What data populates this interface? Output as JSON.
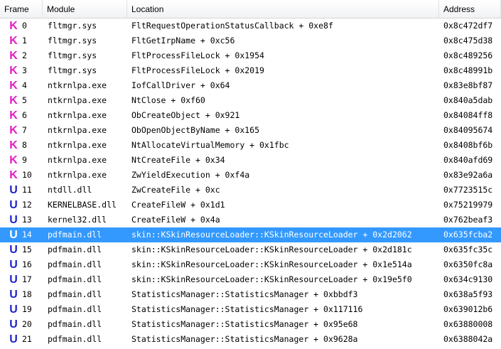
{
  "columns": {
    "frame": "Frame",
    "module": "Module",
    "location": "Location",
    "address": "Address"
  },
  "colors": {
    "kernel_marker": "#e31bc6",
    "user_marker": "#1f22c9",
    "selection": "#3399ff"
  },
  "selected_frame": 14,
  "frames": [
    {
      "kind": "K",
      "frame": "0",
      "module": "fltmgr.sys",
      "location": "FltRequestOperationStatusCallback + 0xe8f",
      "address": "0x8c472df7"
    },
    {
      "kind": "K",
      "frame": "1",
      "module": "fltmgr.sys",
      "location": "FltGetIrpName + 0xc56",
      "address": "0x8c475d38"
    },
    {
      "kind": "K",
      "frame": "2",
      "module": "fltmgr.sys",
      "location": "FltProcessFileLock + 0x1954",
      "address": "0x8c489256"
    },
    {
      "kind": "K",
      "frame": "3",
      "module": "fltmgr.sys",
      "location": "FltProcessFileLock + 0x2019",
      "address": "0x8c48991b"
    },
    {
      "kind": "K",
      "frame": "4",
      "module": "ntkrnlpa.exe",
      "location": "IofCallDriver + 0x64",
      "address": "0x83e8bf87"
    },
    {
      "kind": "K",
      "frame": "5",
      "module": "ntkrnlpa.exe",
      "location": "NtClose + 0xf60",
      "address": "0x840a5dab"
    },
    {
      "kind": "K",
      "frame": "6",
      "module": "ntkrnlpa.exe",
      "location": "ObCreateObject + 0x921",
      "address": "0x84084ff8"
    },
    {
      "kind": "K",
      "frame": "7",
      "module": "ntkrnlpa.exe",
      "location": "ObOpenObjectByName + 0x165",
      "address": "0x84095674"
    },
    {
      "kind": "K",
      "frame": "8",
      "module": "ntkrnlpa.exe",
      "location": "NtAllocateVirtualMemory + 0x1fbc",
      "address": "0x8408bf6b"
    },
    {
      "kind": "K",
      "frame": "9",
      "module": "ntkrnlpa.exe",
      "location": "NtCreateFile + 0x34",
      "address": "0x840afd69"
    },
    {
      "kind": "K",
      "frame": "10",
      "module": "ntkrnlpa.exe",
      "location": "ZwYieldExecution + 0xf4a",
      "address": "0x83e92a6a"
    },
    {
      "kind": "U",
      "frame": "11",
      "module": "ntdll.dll",
      "location": "ZwCreateFile + 0xc",
      "address": "0x7723515c"
    },
    {
      "kind": "U",
      "frame": "12",
      "module": "KERNELBASE.dll",
      "location": "CreateFileW + 0x1d1",
      "address": "0x75219979"
    },
    {
      "kind": "U",
      "frame": "13",
      "module": "kernel32.dll",
      "location": "CreateFileW + 0x4a",
      "address": "0x762beaf3"
    },
    {
      "kind": "U",
      "frame": "14",
      "module": "pdfmain.dll",
      "location": "skin::KSkinResourceLoader::KSkinResourceLoader + 0x2d2062",
      "address": "0x635fcba2"
    },
    {
      "kind": "U",
      "frame": "15",
      "module": "pdfmain.dll",
      "location": "skin::KSkinResourceLoader::KSkinResourceLoader + 0x2d181c",
      "address": "0x635fc35c"
    },
    {
      "kind": "U",
      "frame": "16",
      "module": "pdfmain.dll",
      "location": "skin::KSkinResourceLoader::KSkinResourceLoader + 0x1e514a",
      "address": "0x6350fc8a"
    },
    {
      "kind": "U",
      "frame": "17",
      "module": "pdfmain.dll",
      "location": "skin::KSkinResourceLoader::KSkinResourceLoader + 0x19e5f0",
      "address": "0x634c9130"
    },
    {
      "kind": "U",
      "frame": "18",
      "module": "pdfmain.dll",
      "location": "StatisticsManager::StatisticsManager + 0xbbdf3",
      "address": "0x638a5f93"
    },
    {
      "kind": "U",
      "frame": "19",
      "module": "pdfmain.dll",
      "location": "StatisticsManager::StatisticsManager + 0x117116",
      "address": "0x639012b6"
    },
    {
      "kind": "U",
      "frame": "20",
      "module": "pdfmain.dll",
      "location": "StatisticsManager::StatisticsManager + 0x95e68",
      "address": "0x63880008"
    },
    {
      "kind": "U",
      "frame": "21",
      "module": "pdfmain.dll",
      "location": "StatisticsManager::StatisticsManager + 0x9628a",
      "address": "0x6388042a"
    }
  ]
}
